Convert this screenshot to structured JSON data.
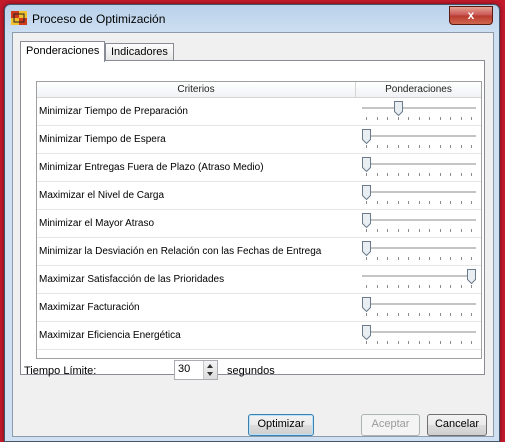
{
  "window": {
    "title": "Proceso de Optimización",
    "close_label": "x"
  },
  "tabs": [
    {
      "label": "Ponderaciones",
      "active": true
    },
    {
      "label": "Indicadores",
      "active": false
    }
  ],
  "grid": {
    "columns": [
      "Criterios",
      "Ponderaciones"
    ],
    "rows": [
      {
        "label": "Minimizar Tiempo de Preparación",
        "value": 0.3
      },
      {
        "label": "Minimizar Tiempo de Espera",
        "value": 0.0
      },
      {
        "label": "Minimizar Entregas Fuera de Plazo (Atraso Medio)",
        "value": 0.0
      },
      {
        "label": "Maximizar el Nivel de Carga",
        "value": 0.0
      },
      {
        "label": "Minimizar el Mayor Atraso",
        "value": 0.0
      },
      {
        "label": "Minimizar la Desviación en Relación con las Fechas de Entrega",
        "value": 0.0
      },
      {
        "label": "Maximizar Satisfacción de las Prioridades",
        "value": 1.0
      },
      {
        "label": "Maximizar Facturación",
        "value": 0.0
      },
      {
        "label": "Maximizar Eficiencia Energética",
        "value": 0.0
      }
    ]
  },
  "time_limit": {
    "label": "Tiempo Límite:",
    "value": "30",
    "units": "segundos"
  },
  "buttons": {
    "optimize": "Optimizar",
    "accept": "Aceptar",
    "cancel": "Cancelar"
  },
  "colors": {
    "background": "#c41a2c",
    "accent": "#3c7fb1"
  }
}
